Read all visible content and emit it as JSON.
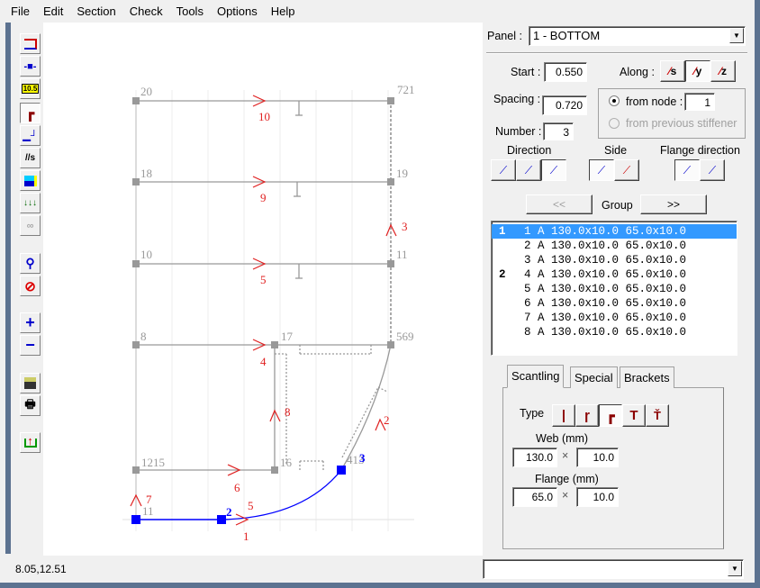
{
  "menu": [
    "File",
    "Edit",
    "Section",
    "Check",
    "Tools",
    "Options",
    "Help"
  ],
  "toolbar": {
    "icons": [
      "panel-icon",
      "node-icon",
      "value-10-5-icon",
      "stiffener-icon",
      "plate-icon",
      "stiffener-s-icon",
      "layers-icon",
      "load-icon",
      "glasses-icon",
      "zoom-icon",
      "no-draw-icon",
      "plus-icon",
      "minus-icon",
      "save-icon",
      "print-icon",
      "export-icon"
    ],
    "value_badge": "10.5"
  },
  "canvas": {
    "node_labels": [
      "20",
      "721",
      "18",
      "19",
      "10",
      "11",
      "8",
      "17",
      "569",
      "1215",
      "16",
      "413",
      "11",
      "2",
      "3"
    ],
    "member_labels": [
      "10",
      "9",
      "5",
      "4",
      "6",
      "1",
      "5",
      "8",
      "3",
      "2",
      "7"
    ],
    "colors": {
      "structure": "#999999",
      "member_label": "#e02020",
      "selected": "#0000ff"
    }
  },
  "panel": {
    "label": "Panel :",
    "value": "1 - BOTTOM",
    "start_label": "Start :",
    "start": "0.550",
    "spacing_label": "Spacing :",
    "spacing": "0.720",
    "number_label": "Number :",
    "number": "3",
    "along_label": "Along :",
    "along_options": [
      "s",
      "y",
      "z"
    ],
    "along_selected": "y",
    "from_node_label": "from node :",
    "from_node": "1",
    "from_prev_label": "from previous stiffener",
    "direction_label": "Direction",
    "side_label": "Side",
    "flange_dir_label": "Flange direction",
    "prev_button": "<<",
    "group_label": "Group",
    "next_button": ">>"
  },
  "stiffeners": [
    {
      "group": "1",
      "text": "1 A 130.0x10.0 65.0x10.0",
      "selected": true
    },
    {
      "group": "",
      "text": "2 A 130.0x10.0 65.0x10.0"
    },
    {
      "group": "",
      "text": "3 A 130.0x10.0 65.0x10.0"
    },
    {
      "group": "2",
      "text": "4 A 130.0x10.0 65.0x10.0"
    },
    {
      "group": "",
      "text": "5 A 130.0x10.0 65.0x10.0"
    },
    {
      "group": "",
      "text": "6 A 130.0x10.0 65.0x10.0"
    },
    {
      "group": "",
      "text": "7 A 130.0x10.0 65.0x10.0"
    },
    {
      "group": "",
      "text": "8 A 130.0x10.0 65.0x10.0"
    }
  ],
  "tabs": [
    "Scantling",
    "Special",
    "Brackets"
  ],
  "scantling": {
    "type_label": "Type",
    "types": [
      "I",
      "flat-bulb",
      "L",
      "T",
      "Y"
    ],
    "type_selected": "L",
    "web_label": "Web (mm)",
    "web_h": "130.0",
    "web_t": "10.0",
    "flange_label": "Flange (mm)",
    "flange_w": "65.0",
    "flange_t": "10.0",
    "times": "×"
  },
  "status": {
    "coords": "8.05,12.51",
    "combo": ""
  },
  "colors": {
    "selection": "#3399ff",
    "accent_red": "#8b0000",
    "frame": "#5c7290"
  }
}
